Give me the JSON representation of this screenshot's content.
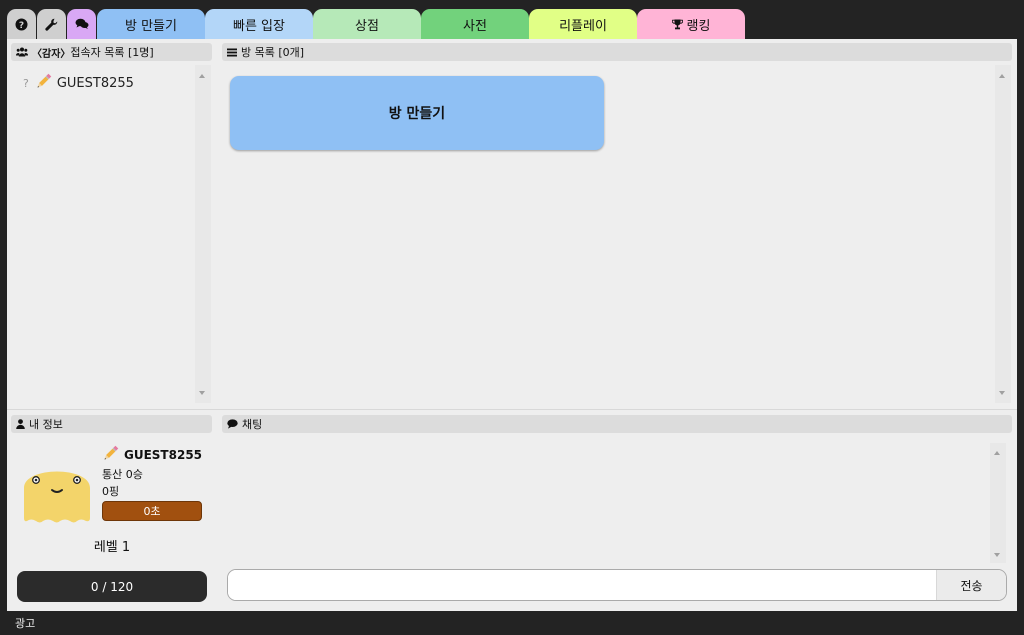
{
  "tabs": {
    "help": {
      "icon": "question-circle-icon",
      "color": "#cfcfcf"
    },
    "settings": {
      "icon": "wrench-icon",
      "color": "#cfcfcf"
    },
    "chat": {
      "icon": "chat-bubbles-icon",
      "color": "#d9a8f5"
    },
    "items": [
      {
        "label": "방 만들기",
        "color": "#8fc0f4"
      },
      {
        "label": "빠른 입장",
        "color": "#b3d6f8"
      },
      {
        "label": "상점",
        "color": "#b6e9b8"
      },
      {
        "label": "사전",
        "color": "#72d27c"
      },
      {
        "label": "리플레이",
        "color": "#e1ff86"
      },
      {
        "label": "랭킹",
        "color": "#ffb4d6",
        "icon": "trophy-icon"
      }
    ]
  },
  "users_panel": {
    "tag": "〈감자〉",
    "title": "접속자 목록 [1명]",
    "icon": "users-icon",
    "list": [
      {
        "status": "?",
        "icon": "pencil-icon",
        "name": "GUEST8255"
      }
    ]
  },
  "rooms_panel": {
    "title": "방 목록 [0개]",
    "icon": "list-icon",
    "create_button": "방 만들기"
  },
  "my_info": {
    "title": "내 정보",
    "icon": "user-icon",
    "name": "GUEST8255",
    "record": "통산 0승",
    "ping": "0핑",
    "time": "0초",
    "time_color": "#a1500f",
    "level": "레벨 1",
    "xp": {
      "current": 0,
      "max": 120,
      "text": "0 / 120"
    }
  },
  "chat": {
    "title": "채팅",
    "icon": "chat-icon",
    "input_placeholder": "",
    "send_label": "전송"
  },
  "footer": {
    "ad_label": "광고"
  }
}
